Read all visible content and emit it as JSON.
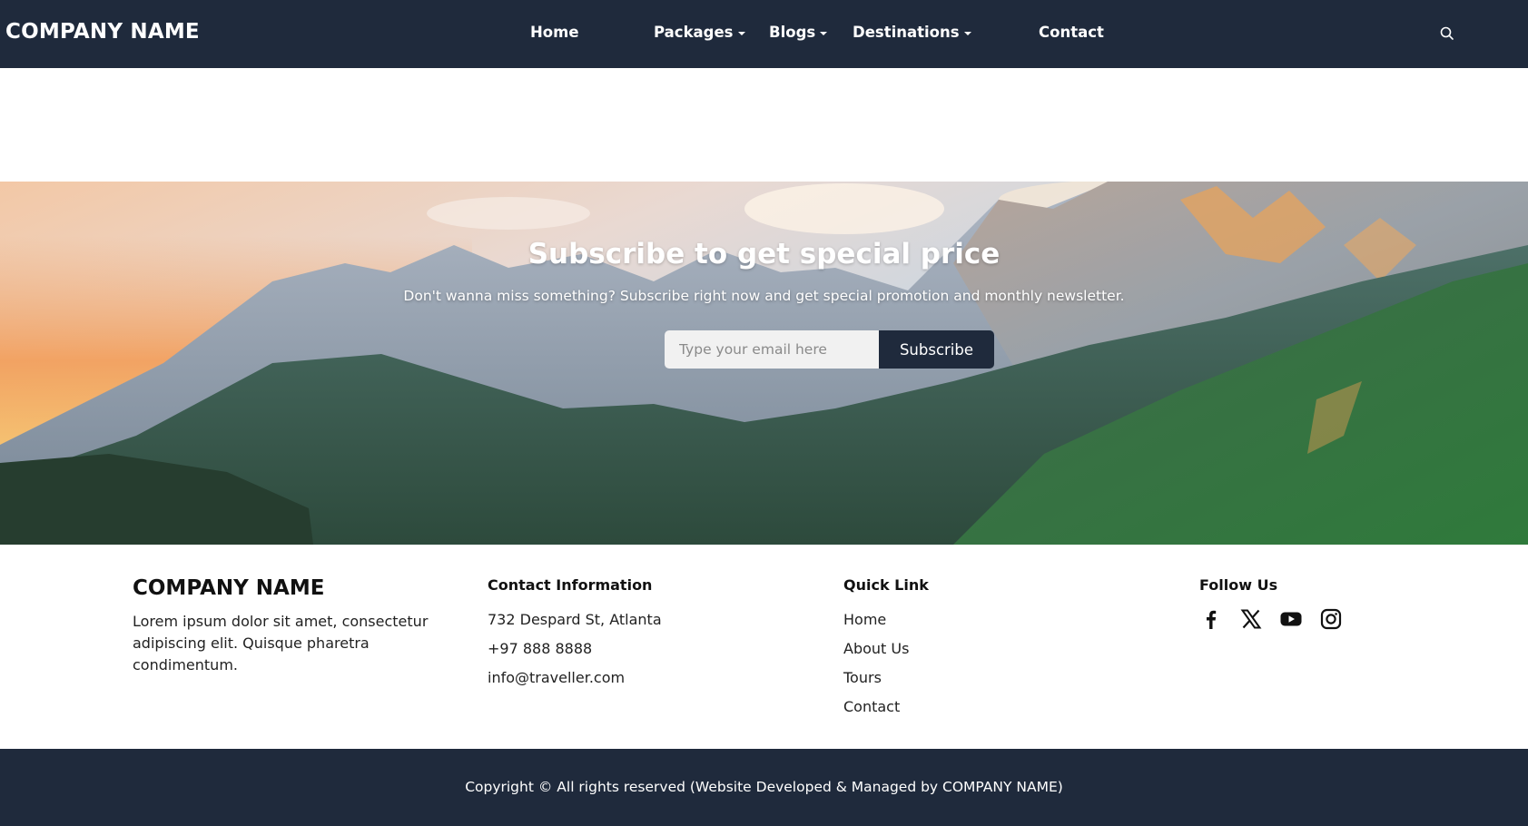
{
  "navbar": {
    "brand": "COMPANY NAME",
    "items": [
      {
        "label": "Home",
        "has_dropdown": false
      },
      {
        "label": "Packages",
        "has_dropdown": true
      },
      {
        "label": "Blogs",
        "has_dropdown": true
      },
      {
        "label": "Destinations",
        "has_dropdown": true
      },
      {
        "label": "Contact",
        "has_dropdown": false
      }
    ],
    "search_icon": "search-icon"
  },
  "hero": {
    "title": "Subscribe to get special price",
    "subtitle": "Don't wanna miss something? Subscribe right now and get special promotion and monthly newsletter.",
    "email_placeholder": "Type your email here",
    "button_label": "Subscribe"
  },
  "footer": {
    "brand": "COMPANY NAME",
    "description": "Lorem ipsum dolor sit amet, consectetur adipiscing elit. Quisque pharetra condimentum.",
    "contact": {
      "heading": "Contact Information",
      "address": "732 Despard St, Atlanta",
      "phone": "+97 888 8888",
      "email": "info@traveller.com"
    },
    "quick_links": {
      "heading": "Quick Link",
      "items": [
        "Home",
        "About Us",
        "Tours",
        "Contact"
      ]
    },
    "follow": {
      "heading": "Follow Us",
      "icons": [
        "facebook-icon",
        "x-icon",
        "youtube-icon",
        "instagram-icon"
      ]
    }
  },
  "copyright": "Copyright © All rights reserved (Website Developed & Managed by COMPANY NAME)",
  "colors": {
    "navy": "#1f2a3c",
    "white": "#ffffff"
  }
}
